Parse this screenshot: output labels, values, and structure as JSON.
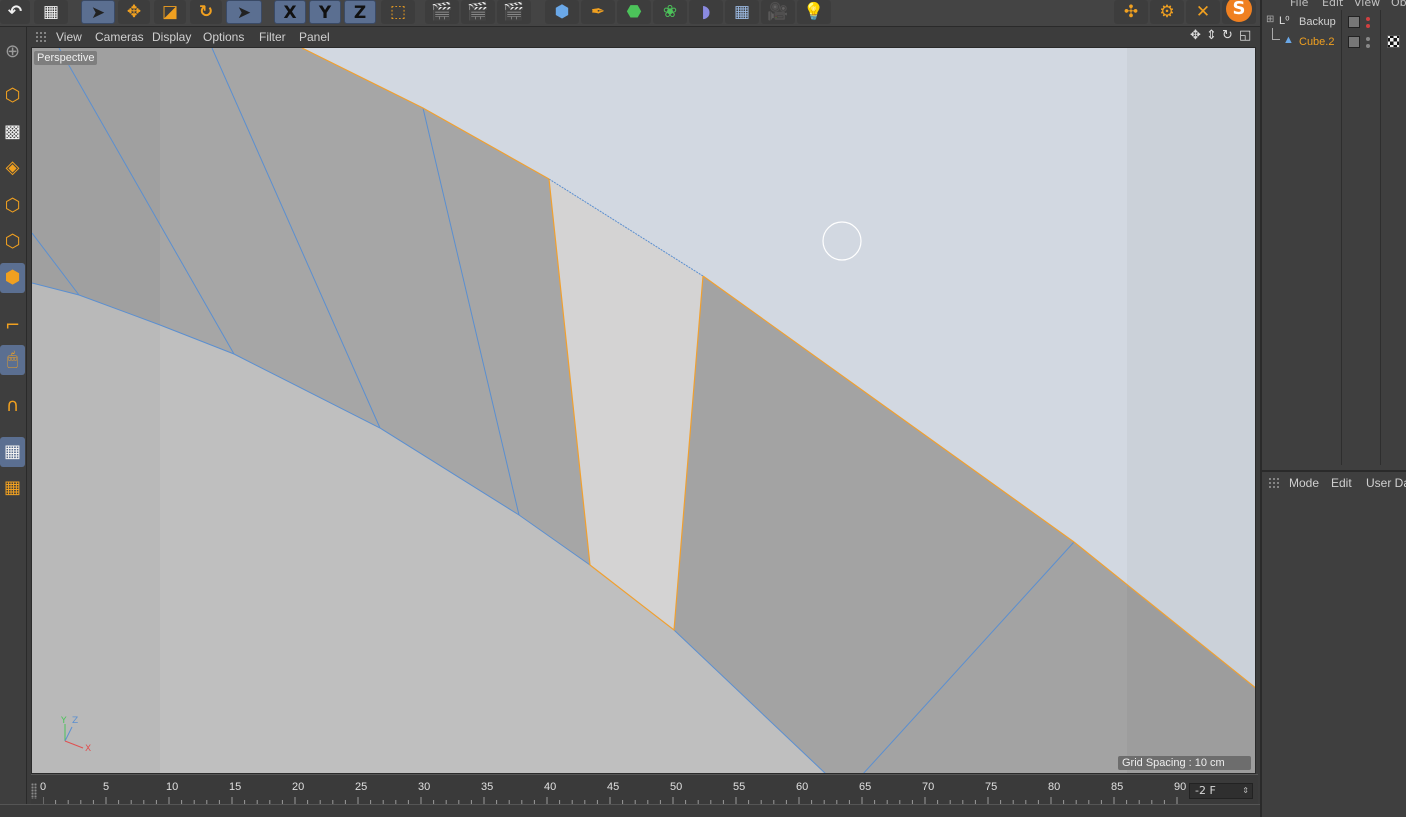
{
  "viewport_menu": {
    "items": [
      "View",
      "Cameras",
      "Display",
      "Options",
      "Filter",
      "Panel"
    ]
  },
  "viewport": {
    "camera_label": "Perspective",
    "grid_spacing": "Grid Spacing : 10 cm",
    "axis_labels": {
      "y": "Y",
      "z": "Z",
      "x": "X"
    }
  },
  "toolbar": {
    "axis_x": "X",
    "axis_y": "Y",
    "axis_z": "Z"
  },
  "timeline": {
    "ticks": [
      "0",
      "5",
      "10",
      "15",
      "20",
      "25",
      "30",
      "35",
      "40",
      "45",
      "50",
      "55",
      "60",
      "65",
      "70",
      "75",
      "80",
      "85",
      "90"
    ],
    "current_frame": "-2 F"
  },
  "object_manager": {
    "menu": [
      "File",
      "Edit",
      "View",
      "Ob"
    ],
    "objects": [
      {
        "name": "Backup",
        "color": "#d2d2d2"
      },
      {
        "name": "Cube.2",
        "color": "#f0a020"
      }
    ]
  },
  "attribute_manager": {
    "menu": [
      "Mode",
      "Edit",
      "User Data"
    ]
  },
  "colors": {
    "selection_edge": "#f0a030",
    "edge_blue": "#5b8fd0",
    "active_button": "#5b6f91"
  }
}
